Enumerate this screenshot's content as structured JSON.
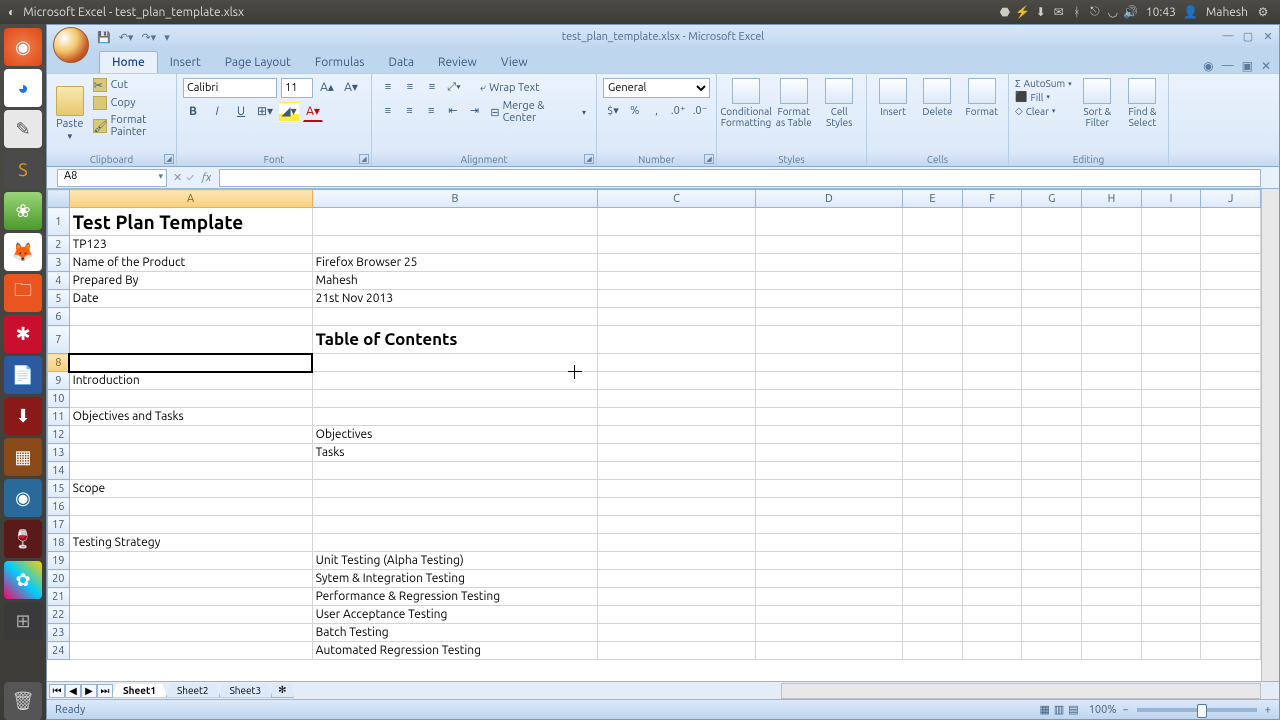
{
  "ubuntu": {
    "window_title": "Microsoft Excel - test_plan_template.xlsx",
    "time": "10:43",
    "user": "Mahesh"
  },
  "excel": {
    "doc_title": "test_plan_template.xlsx - Microsoft Excel",
    "tabs": [
      "Home",
      "Insert",
      "Page Layout",
      "Formulas",
      "Data",
      "Review",
      "View"
    ],
    "clipboard": {
      "paste": "Paste",
      "cut": "Cut",
      "copy": "Copy",
      "format_painter": "Format Painter",
      "label": "Clipboard"
    },
    "font": {
      "name": "Calibri",
      "size": "11",
      "label": "Font"
    },
    "alignment": {
      "wrap": "Wrap Text",
      "merge": "Merge & Center",
      "label": "Alignment"
    },
    "number": {
      "format": "General",
      "label": "Number"
    },
    "styles": {
      "cond": "Conditional Formatting",
      "fmt_table": "Format as Table",
      "cell_styles": "Cell Styles",
      "label": "Styles"
    },
    "cells": {
      "insert": "Insert",
      "delete": "Delete",
      "format": "Format",
      "label": "Cells"
    },
    "editing": {
      "autosum": "AutoSum",
      "fill": "Fill",
      "clear": "Clear",
      "sort": "Sort & Filter",
      "find": "Find & Select",
      "label": "Editing"
    },
    "name_box": "A8",
    "columns": [
      "A",
      "B",
      "C",
      "D",
      "E",
      "F",
      "G",
      "H",
      "I",
      "J"
    ],
    "rows": [
      {
        "n": 1,
        "a": "Test Plan Template",
        "b": ""
      },
      {
        "n": 2,
        "a": "TP123",
        "b": ""
      },
      {
        "n": 3,
        "a": "Name of the Product",
        "b": "Firefox Browser 25"
      },
      {
        "n": 4,
        "a": "Prepared By",
        "b": "Mahesh"
      },
      {
        "n": 5,
        "a": "Date",
        "b": "21st Nov 2013"
      },
      {
        "n": 6,
        "a": "",
        "b": ""
      },
      {
        "n": 7,
        "a": "",
        "b": "Table of Contents"
      },
      {
        "n": 8,
        "a": "",
        "b": ""
      },
      {
        "n": 9,
        "a": "Introduction",
        "b": ""
      },
      {
        "n": 10,
        "a": "",
        "b": ""
      },
      {
        "n": 11,
        "a": "Objectives and Tasks",
        "b": ""
      },
      {
        "n": 12,
        "a": "",
        "b": "Objectives"
      },
      {
        "n": 13,
        "a": "",
        "b": "Tasks"
      },
      {
        "n": 14,
        "a": "",
        "b": ""
      },
      {
        "n": 15,
        "a": "Scope",
        "b": ""
      },
      {
        "n": 16,
        "a": "",
        "b": ""
      },
      {
        "n": 17,
        "a": "",
        "b": ""
      },
      {
        "n": 18,
        "a": "Testing Strategy",
        "b": ""
      },
      {
        "n": 19,
        "a": "",
        "b": "Unit Testing (Alpha Testing)"
      },
      {
        "n": 20,
        "a": "",
        "b": "Sytem & Integration Testing"
      },
      {
        "n": 21,
        "a": "",
        "b": "Performance & Regression Testing"
      },
      {
        "n": 22,
        "a": "",
        "b": "User Acceptance Testing"
      },
      {
        "n": 23,
        "a": "",
        "b": "Batch Testing"
      },
      {
        "n": 24,
        "a": "",
        "b": "Automated Regression Testing"
      }
    ],
    "sheets": [
      "Sheet1",
      "Sheet2",
      "Sheet3"
    ],
    "status": "Ready",
    "zoom": "100%"
  }
}
